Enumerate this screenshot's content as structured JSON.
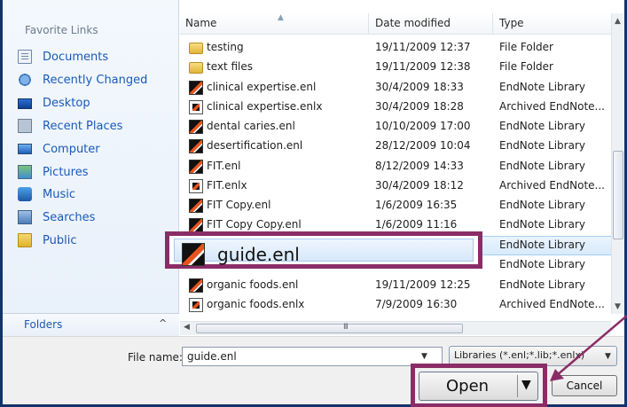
{
  "colors": {
    "accent_highlight": "#8a2d67",
    "link_text": "#1a5ab8",
    "selection": "#d8eafb"
  },
  "nav": {
    "header": "Favorite Links",
    "items": [
      {
        "label": "Documents",
        "icon": "documents-icon"
      },
      {
        "label": "Recently Changed",
        "icon": "recently-changed-icon"
      },
      {
        "label": "Desktop",
        "icon": "desktop-icon"
      },
      {
        "label": "Recent Places",
        "icon": "recent-places-icon"
      },
      {
        "label": "Computer",
        "icon": "computer-icon"
      },
      {
        "label": "Pictures",
        "icon": "pictures-icon"
      },
      {
        "label": "Music",
        "icon": "music-icon"
      },
      {
        "label": "Searches",
        "icon": "searches-icon"
      },
      {
        "label": "Public",
        "icon": "public-folder-icon"
      }
    ],
    "folders_label": "Folders",
    "folders_chevron": "^"
  },
  "columns": {
    "name": "Name",
    "date": "Date modified",
    "type": "Type"
  },
  "files": [
    {
      "name": "testing",
      "date": "19/11/2009 12:37",
      "type": "File Folder",
      "icon": "folder-icon"
    },
    {
      "name": "text files",
      "date": "19/11/2009 12:38",
      "type": "File Folder",
      "icon": "folder-icon"
    },
    {
      "name": "clinical expertise.enl",
      "date": "30/4/2009 18:33",
      "type": "EndNote Library",
      "icon": "endnote-library-icon"
    },
    {
      "name": "clinical expertise.enlx",
      "date": "30/4/2009 18:28",
      "type": "Archived EndNote...",
      "icon": "endnote-archive-icon"
    },
    {
      "name": "dental caries.enl",
      "date": "10/10/2009 17:00",
      "type": "EndNote Library",
      "icon": "endnote-library-icon"
    },
    {
      "name": "desertification.enl",
      "date": "28/12/2009 10:04",
      "type": "EndNote Library",
      "icon": "endnote-library-icon"
    },
    {
      "name": "FIT.enl",
      "date": "8/12/2009 14:33",
      "type": "EndNote Library",
      "icon": "endnote-library-icon"
    },
    {
      "name": "FIT.enlx",
      "date": "30/4/2009 18:12",
      "type": "Archived EndNote...",
      "icon": "endnote-archive-icon"
    },
    {
      "name": "FIT Copy.enl",
      "date": "1/6/2009 16:35",
      "type": "EndNote Library",
      "icon": "endnote-library-icon"
    },
    {
      "name": "FIT Copy Copy.enl",
      "date": "1/6/2009 11:16",
      "type": "EndNote Library",
      "icon": "endnote-library-icon"
    },
    {
      "name": "",
      "date": "",
      "type": "EndNote Library",
      "icon": ""
    },
    {
      "name": "",
      "date": "",
      "type": "EndNote Library",
      "icon": ""
    },
    {
      "name": "organic foods.enl",
      "date": "19/11/2009 12:25",
      "type": "EndNote Library",
      "icon": "endnote-library-icon"
    },
    {
      "name": "organic foods.enlx",
      "date": "7/9/2009 16:30",
      "type": "Archived EndNote...",
      "icon": "endnote-archive-icon"
    }
  ],
  "selected_file": {
    "name": "guide.enl"
  },
  "scroll": {
    "h_grip": "III"
  },
  "bottom": {
    "file_name_label": "File name:",
    "file_name_value": "guide.enl",
    "file_type_value": "Libraries (*.enl;*.lib;*.enlx)",
    "open_label": "Open",
    "cancel_label": "Cancel"
  }
}
